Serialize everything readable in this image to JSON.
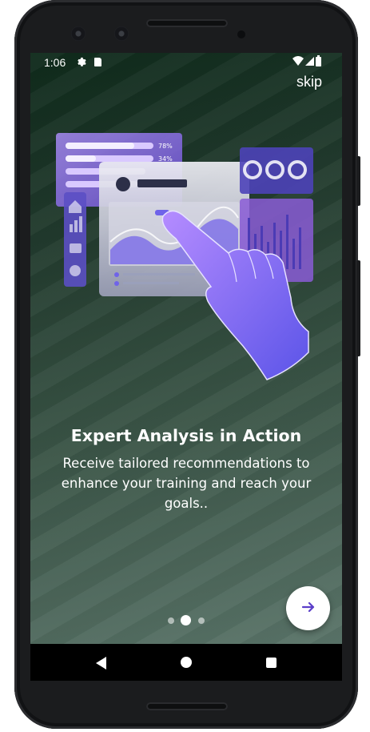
{
  "status_bar": {
    "time": "1:06",
    "icons": [
      "gear-icon",
      "sd-card-icon",
      "wifi-icon",
      "signal-icon",
      "battery-icon"
    ]
  },
  "onboarding": {
    "skip_label": "skip",
    "title": "Expert Analysis in Action",
    "description": "Receive tailored recommendations to enhance your training and reach your goals..",
    "illustration": {
      "progress_labels": [
        "78%",
        "34%"
      ],
      "icon": "analytics-dashboard-hand-illustration"
    },
    "page_indicator": {
      "total": 3,
      "active": 2
    },
    "next_button_icon": "arrow-right-icon"
  },
  "navigation_bar": {
    "icons": [
      "back-icon",
      "home-icon",
      "recents-icon"
    ]
  },
  "colors": {
    "accent": "#8e6cf0",
    "background_top": "#0f2a1b",
    "background_bottom": "#5a7469"
  }
}
